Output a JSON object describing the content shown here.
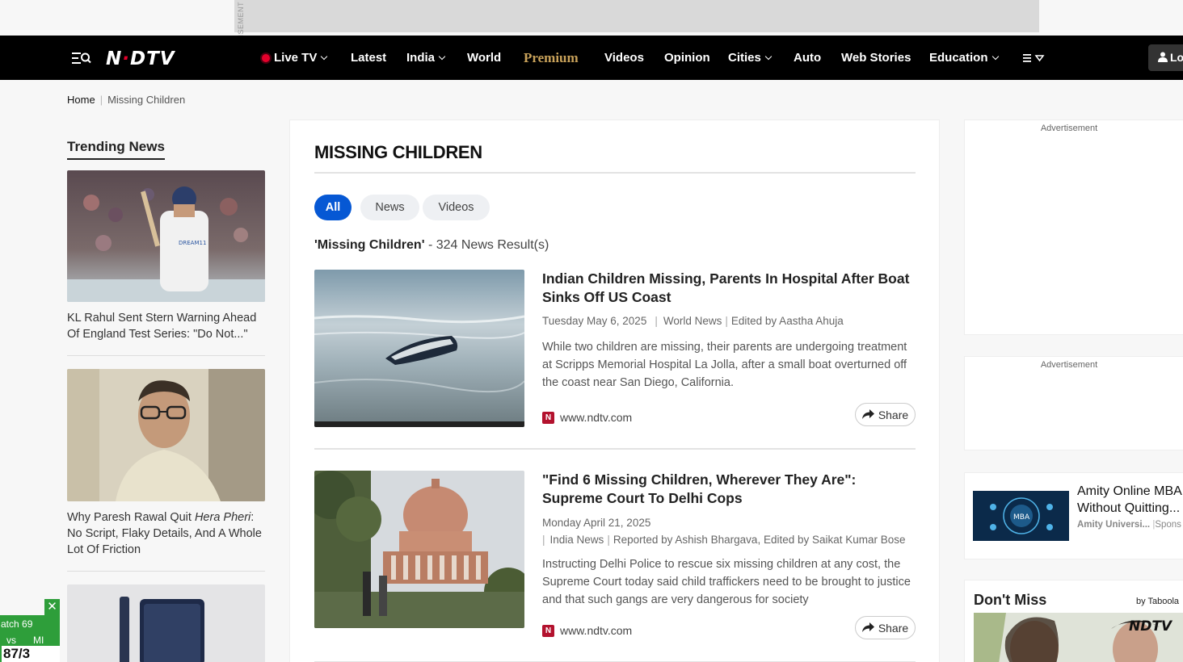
{
  "top_ad": {
    "label": "ADVERTISEMENT"
  },
  "navbar": {
    "logo": "NDTV",
    "items": {
      "live_tv": "Live TV",
      "latest": "Latest",
      "india": "India",
      "world": "World",
      "premium": "Premium",
      "videos": "Videos",
      "opinion": "Opinion",
      "cities": "Cities",
      "auto": "Auto",
      "web_stories": "Web Stories",
      "education": "Education"
    },
    "login_label": "Lo"
  },
  "breadcrumb": {
    "home": "Home",
    "current": "Missing Children"
  },
  "trending": {
    "title": "Trending News",
    "items": [
      {
        "title": "KL Rahul Sent Stern Warning Ahead Of England Test Series: \"Do Not...\""
      },
      {
        "title_pre": "Why Paresh Rawal Quit ",
        "title_em": "Hera Pheri",
        "title_post": ": No Script, Flaky Details, And A Whole Lot Of Friction"
      },
      {
        "title": ""
      }
    ]
  },
  "main": {
    "page_title": "MISSING CHILDREN",
    "tabs": {
      "all": "All",
      "news": "News",
      "videos": "Videos"
    },
    "result_query": "'Missing Children'",
    "result_text": " - 324 News Result(s)",
    "articles": [
      {
        "title": "Indian Children Missing, Parents In Hospital After Boat Sinks Off US Coast",
        "date": "Tuesday May 6, 2025",
        "category": "World News",
        "credit": "Edited by Aastha Ahuja",
        "description": "While two children are missing, their parents are undergoing treatment at Scripps Memorial Hospital La Jolla, after a small boat overturned off the coast near San Diego, California.",
        "source": "www.ndtv.com",
        "share": "Share"
      },
      {
        "title": "\"Find 6 Missing Children, Wherever They Are\": Supreme Court To Delhi Cops",
        "date": "Monday April 21, 2025",
        "category": "India News",
        "credit": "Reported by Ashish Bhargava, Edited by Saikat Kumar Bose",
        "description": "Instructing Delhi Police to rescue six missing children at any cost, the Supreme Court today said child traffickers need to be brought to justice and that such gangs are very dangerous for society",
        "source": "www.ndtv.com",
        "share": "Share"
      }
    ]
  },
  "sidebar": {
    "ad1_label": "Advertisement",
    "ad2_label": "Advertisement",
    "sponsored": {
      "title_line1": "Amity Online MBA",
      "title_line2": "Without Quitting...",
      "source": "Amity Universi...",
      "sponsored": "Spons"
    },
    "dont_miss": {
      "title": "Don't Miss",
      "by": "by Taboola"
    }
  },
  "score_widget": {
    "match": "atch 69",
    "teams_vs": "vs",
    "team2": "MI",
    "score": "87/3",
    "close": "✕"
  },
  "colors": {
    "brand_red": "#e4002b",
    "accent_blue": "#0658d4",
    "premium_gold": "#c9a25a",
    "score_green": "#2e9e3a"
  }
}
